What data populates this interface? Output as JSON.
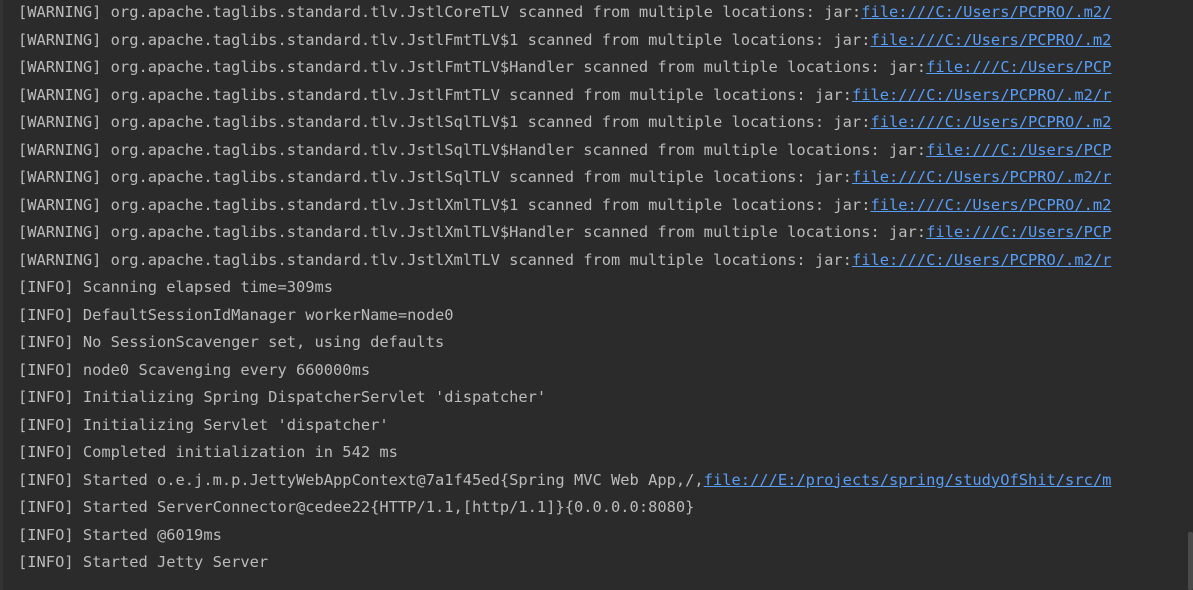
{
  "console": {
    "lines": [
      {
        "prefix": "[WARNING] org.apache.taglibs.standard.tlv.JstlCoreTLV scanned from multiple locations: jar:",
        "link": "file:///C:/Users/PCPRO/.m2/"
      },
      {
        "prefix": "[WARNING] org.apache.taglibs.standard.tlv.JstlFmtTLV$1 scanned from multiple locations: jar:",
        "link": "file:///C:/Users/PCPRO/.m2"
      },
      {
        "prefix": "[WARNING] org.apache.taglibs.standard.tlv.JstlFmtTLV$Handler scanned from multiple locations: jar:",
        "link": "file:///C:/Users/PCP"
      },
      {
        "prefix": "[WARNING] org.apache.taglibs.standard.tlv.JstlFmtTLV scanned from multiple locations: jar:",
        "link": "file:///C:/Users/PCPRO/.m2/r"
      },
      {
        "prefix": "[WARNING] org.apache.taglibs.standard.tlv.JstlSqlTLV$1 scanned from multiple locations: jar:",
        "link": "file:///C:/Users/PCPRO/.m2"
      },
      {
        "prefix": "[WARNING] org.apache.taglibs.standard.tlv.JstlSqlTLV$Handler scanned from multiple locations: jar:",
        "link": "file:///C:/Users/PCP"
      },
      {
        "prefix": "[WARNING] org.apache.taglibs.standard.tlv.JstlSqlTLV scanned from multiple locations: jar:",
        "link": "file:///C:/Users/PCPRO/.m2/r"
      },
      {
        "prefix": "[WARNING] org.apache.taglibs.standard.tlv.JstlXmlTLV$1 scanned from multiple locations: jar:",
        "link": "file:///C:/Users/PCPRO/.m2"
      },
      {
        "prefix": "[WARNING] org.apache.taglibs.standard.tlv.JstlXmlTLV$Handler scanned from multiple locations: jar:",
        "link": "file:///C:/Users/PCP"
      },
      {
        "prefix": "[WARNING] org.apache.taglibs.standard.tlv.JstlXmlTLV scanned from multiple locations: jar:",
        "link": "file:///C:/Users/PCPRO/.m2/r"
      },
      {
        "prefix": "[INFO] Scanning elapsed time=309ms",
        "link": ""
      },
      {
        "prefix": "[INFO] DefaultSessionIdManager workerName=node0",
        "link": ""
      },
      {
        "prefix": "[INFO] No SessionScavenger set, using defaults",
        "link": ""
      },
      {
        "prefix": "[INFO] node0 Scavenging every 660000ms",
        "link": ""
      },
      {
        "prefix": "[INFO] Initializing Spring DispatcherServlet 'dispatcher'",
        "link": ""
      },
      {
        "prefix": "[INFO] Initializing Servlet 'dispatcher'",
        "link": ""
      },
      {
        "prefix": "[INFO] Completed initialization in 542 ms",
        "link": ""
      },
      {
        "prefix": "[INFO] Started o.e.j.m.p.JettyWebAppContext@7a1f45ed{Spring MVC Web App,/,",
        "link": "file:///E:/projects/spring/studyOfShit/src/m"
      },
      {
        "prefix": "[INFO] Started ServerConnector@cedee22{HTTP/1.1,[http/1.1]}{0.0.0.0:8080}",
        "link": ""
      },
      {
        "prefix": "[INFO] Started @6019ms",
        "link": ""
      },
      {
        "prefix": "[INFO] Started Jetty Server",
        "link": ""
      }
    ]
  },
  "colors": {
    "background": "#2b2b2b",
    "text": "#bbbbbb",
    "link": "#589df6"
  }
}
